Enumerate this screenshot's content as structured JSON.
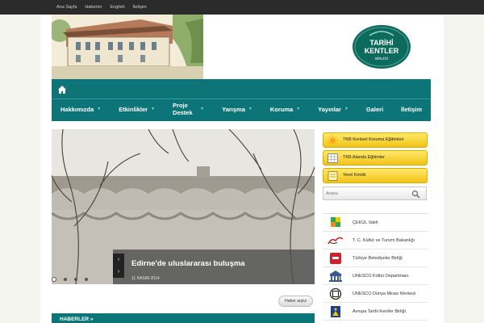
{
  "top_links": [
    "Ana Sayfa",
    "Haberler",
    "English",
    "İletişim"
  ],
  "logo": {
    "line1": "TARİHİ",
    "line2": "KENTLER",
    "line3": "BİRLİĞİ"
  },
  "nav": {
    "home_icon": "home-icon",
    "items": [
      {
        "label": "Hakkımızda",
        "has_submenu": true
      },
      {
        "label": "Etkinlikler",
        "has_submenu": true
      },
      {
        "label": "Proje Destek",
        "has_submenu": true
      },
      {
        "label": "Yarışma",
        "has_submenu": true
      },
      {
        "label": "Koruma",
        "has_submenu": true
      },
      {
        "label": "Yayınlar",
        "has_submenu": true
      },
      {
        "label": "Galeri",
        "has_submenu": false
      },
      {
        "label": "İletişim",
        "has_submenu": false
      }
    ]
  },
  "slider": {
    "title": "Edirne'de uluslararası buluşma",
    "date": "11 KASIM 2014",
    "prev": "‹",
    "next": "›",
    "dot_count": 4,
    "active_dot": 0
  },
  "archive_button": "Haber arşivi",
  "news_section_title": "HABERLER »",
  "sidebar_buttons": [
    {
      "label": "TKB Kentsel Koruma Eğitimleri",
      "icon": "sun-icon"
    },
    {
      "label": "TKB Alanda Eğitimler",
      "icon": "grid-icon"
    },
    {
      "label": "Yerel Kimlik",
      "icon": "note-icon"
    }
  ],
  "search": {
    "placeholder": "Arama"
  },
  "partner_links": [
    {
      "label": "ÇEKÜL Vakfı",
      "icon": "cekul-logo-icon"
    },
    {
      "label": "T. C. Kültür ve Turizm Bakanlığı",
      "icon": "turkiye-logo-icon"
    },
    {
      "label": "Türkiye Belediyeler Birliği",
      "icon": "tbb-logo-icon"
    },
    {
      "label": "UNESCO Kültür Departmanı",
      "icon": "unesco-logo-icon"
    },
    {
      "label": "UNESCO Dünya Mirası Merkezi",
      "icon": "world-heritage-icon"
    },
    {
      "label": "Avrupa Tarihi Kentler Birliği",
      "icon": "efhc-logo-icon"
    }
  ],
  "colors": {
    "teal": "#0d7477",
    "topbar": "#2b2b2b",
    "yellow": "#f7d233"
  }
}
